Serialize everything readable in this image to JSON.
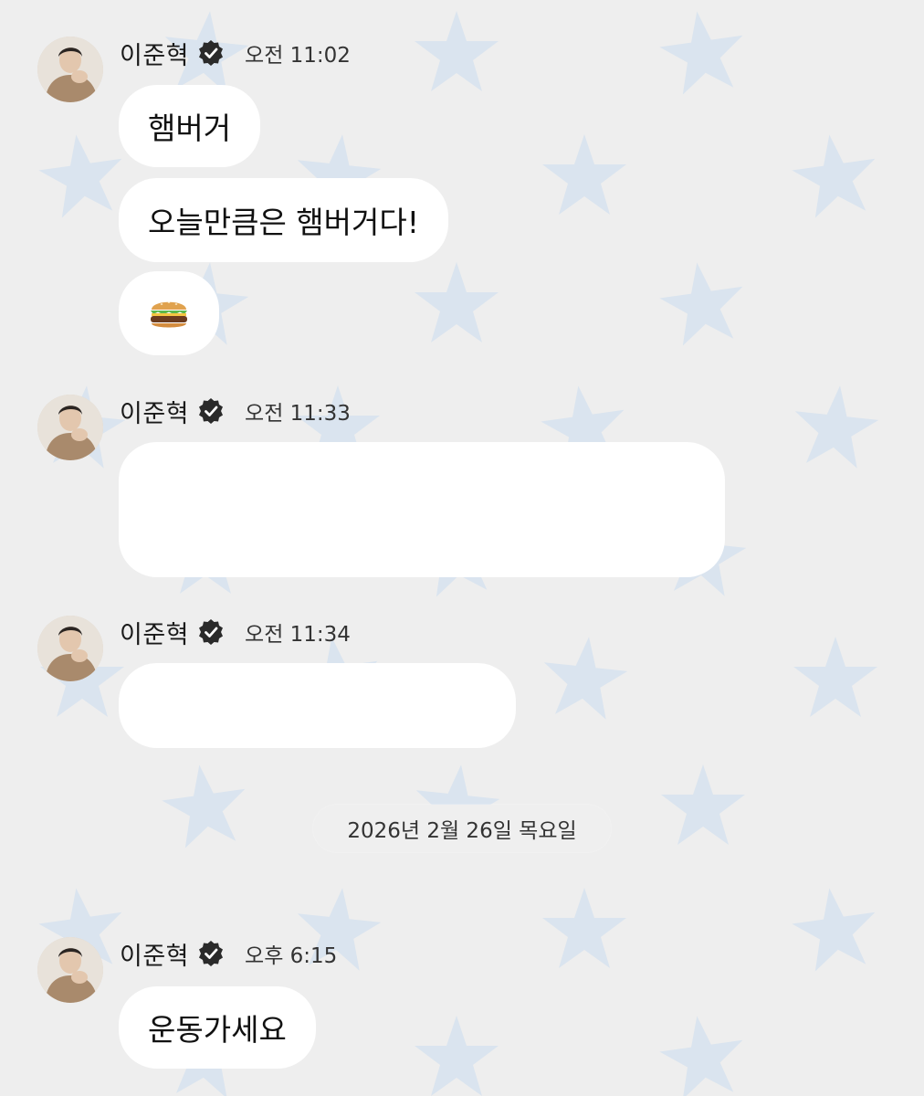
{
  "chat": {
    "messages": [
      {
        "sender": "이준혁",
        "time": "오전 11:02",
        "bubbles": [
          {
            "text": "햄버거"
          },
          {
            "text": "오늘만큼은 햄버거다!"
          },
          {
            "text": "",
            "icon": "hamburger-emoji"
          }
        ]
      },
      {
        "sender": "이준혁",
        "time": "오전 11:33",
        "bubbles": [
          {
            "text": ""
          }
        ]
      },
      {
        "sender": "이준혁",
        "time": "오전 11:34",
        "bubbles": [
          {
            "text": ""
          }
        ]
      },
      {
        "sender": "이준혁",
        "time": "오후 6:15",
        "bubbles": [
          {
            "text": "운동가세요"
          }
        ]
      }
    ],
    "date_separator": "2026년 2월 26일 목요일"
  },
  "icons": {
    "verified": "verified-badge-icon",
    "background": "star-pattern"
  },
  "colors": {
    "background": "#eeeeee",
    "star": "#dce6f0",
    "bubble": "#ffffff",
    "text": "#111111"
  }
}
